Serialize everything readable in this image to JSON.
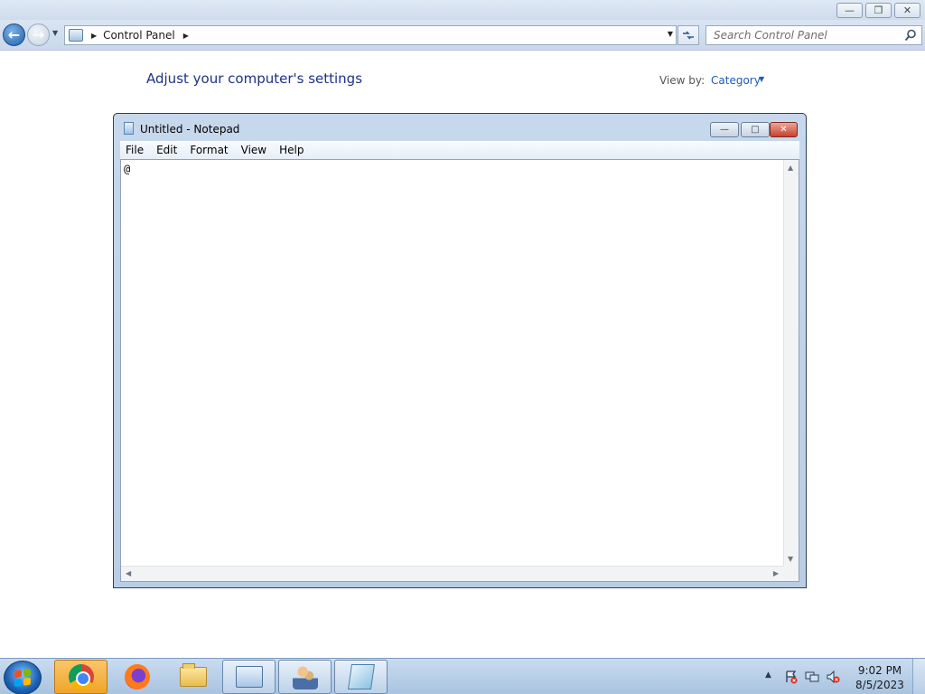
{
  "explorer": {
    "breadcrumb": [
      "Control Panel"
    ],
    "search_placeholder": "Search Control Panel",
    "page_title": "Adjust your computer's settings",
    "view_by_label": "View by:",
    "view_by_value": "Category"
  },
  "notepad": {
    "title": "Untitled - Notepad",
    "menu": [
      "File",
      "Edit",
      "Format",
      "View",
      "Help"
    ],
    "content": "@"
  },
  "taskbar": {
    "pinned": [
      "chrome-icon",
      "firefox-icon",
      "folder-icon",
      "control-panel-icon",
      "users-icon",
      "notepad-icon"
    ],
    "clock_time": "9:02 PM",
    "clock_date": "8/5/2023"
  },
  "colors": {
    "title_blue": "#1e3287",
    "link_blue": "#1e5bb8",
    "close_red": "#c8412f"
  }
}
